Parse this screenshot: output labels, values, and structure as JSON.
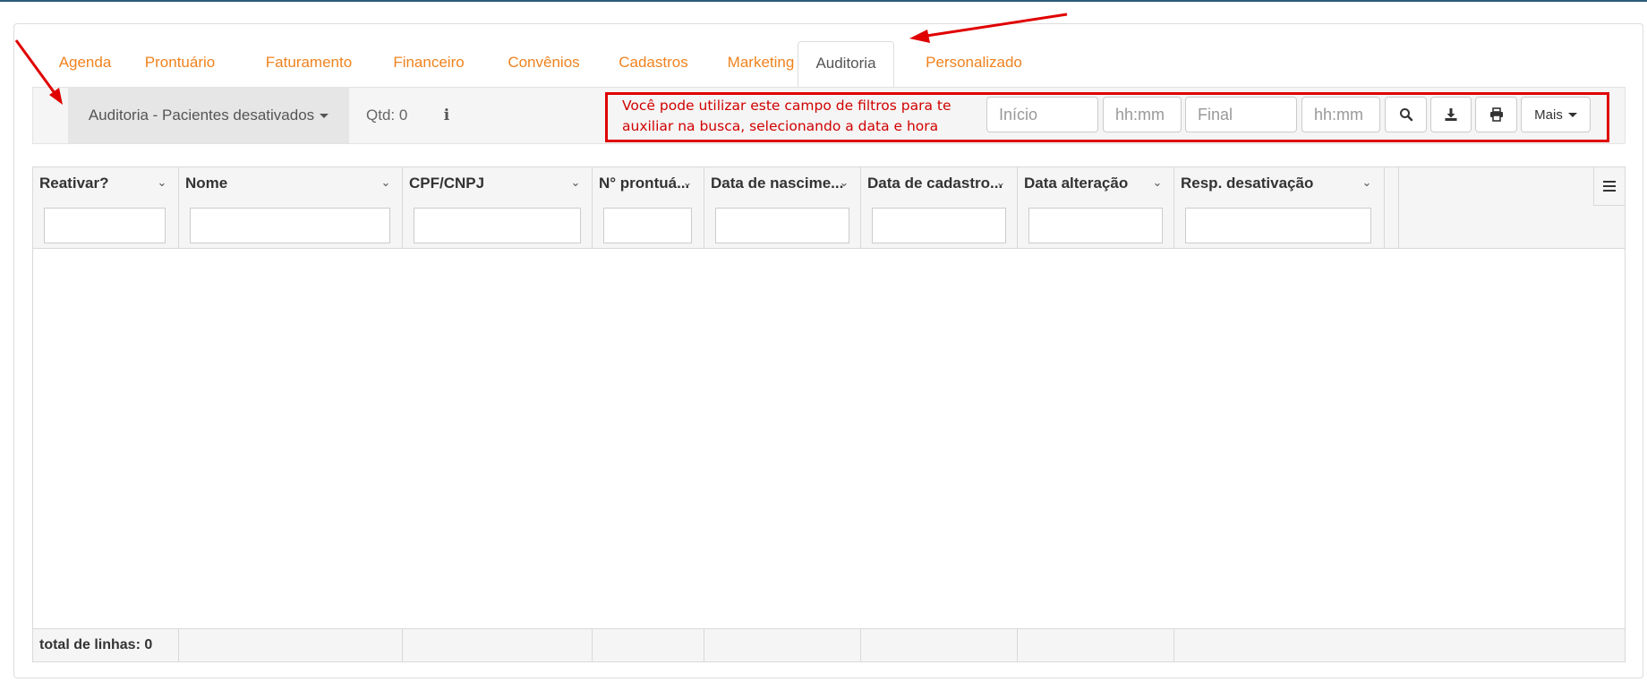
{
  "tabs": [
    "Agenda",
    "Prontuário",
    "Faturamento",
    "Financeiro",
    "Convênios",
    "Cadastros",
    "Marketing",
    "Auditoria",
    "Personalizado"
  ],
  "active_tab": "Auditoria",
  "toolbar": {
    "report_select": "Auditoria - Pacientes desativados",
    "qtd": "Qtd: 0",
    "info_icon": "info-icon",
    "annotation": "Você pode utilizar este campo de filtros para te auxiliar na busca, selecionando a data e hora",
    "annotation_line1": "Você pode utilizar este campo de filtros para te",
    "annotation_line2": "auxiliar na busca, selecionando a data e hora",
    "start_date_placeholder": "Início",
    "start_time_placeholder": "hh:mm",
    "end_date_placeholder": "Final",
    "end_time_placeholder": "hh:mm",
    "search_icon": "search-icon",
    "download_icon": "download-icon",
    "print_icon": "print-icon",
    "more_label": "Mais"
  },
  "grid": {
    "columns": [
      "Reativar?",
      "Nome",
      "CPF/CNPJ",
      "N° prontuá...",
      "Data de nascime...",
      "Data de cadastro...",
      "Data alteração",
      "Resp. desativação"
    ],
    "menu_icon": "hamburger-menu-icon",
    "rows": [],
    "footer_label": "total de linhas: 0"
  },
  "colors": {
    "accent_orange": "#f0821e",
    "annotation_red": "#e00000",
    "header_bg": "#f5f5f5"
  }
}
